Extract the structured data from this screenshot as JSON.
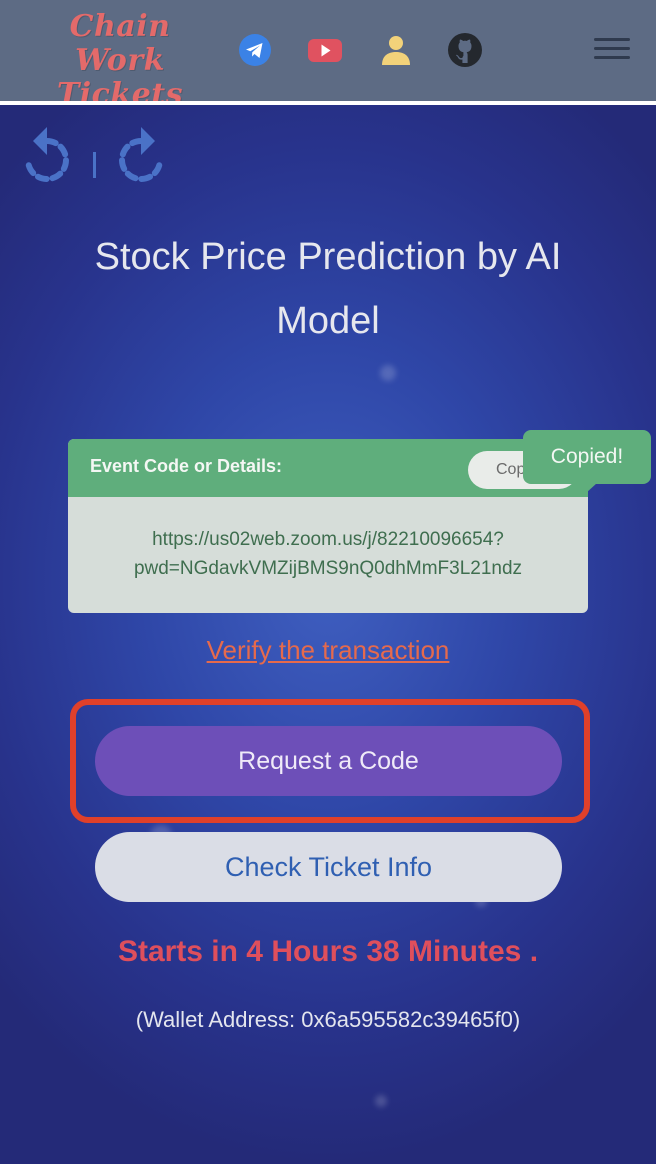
{
  "header": {
    "logo_line1": "Chain Work",
    "logo_line2": "Tickets",
    "icons": [
      "telegram-icon",
      "youtube-icon",
      "user-icon",
      "github-icon",
      "menu-icon"
    ]
  },
  "nav": {
    "back_icon": "undo-icon",
    "forward_icon": "redo-icon"
  },
  "page": {
    "title_line1": "Stock Price Prediction by AI",
    "title_line2": "Model"
  },
  "event_card": {
    "label": "Event Code or Details:",
    "copy_button_label": "Copy",
    "code_line1": "https://us02web.zoom.us/j/82210096654?",
    "code_line2": "pwd=NGdavkVMZijBMS9nQ0dhMmF3L21ndz"
  },
  "tooltip": {
    "text": "Copied!"
  },
  "actions": {
    "verify_link": "Verify the transaction",
    "request_button": "Request a Code",
    "check_button": "Check Ticket Info"
  },
  "status": {
    "countdown": "Starts in 4 Hours 38 Minutes .",
    "wallet": "(Wallet Address: 0x6a595582c39465f0)"
  },
  "colors": {
    "header_bg": "#5d6b84",
    "logo": "#e46a6a",
    "card_header": "#5fae7c",
    "request_button": "#6d4fb8",
    "highlight_border": "#e0402a",
    "countdown": "#df4f5c",
    "link": "#e66a4c"
  }
}
